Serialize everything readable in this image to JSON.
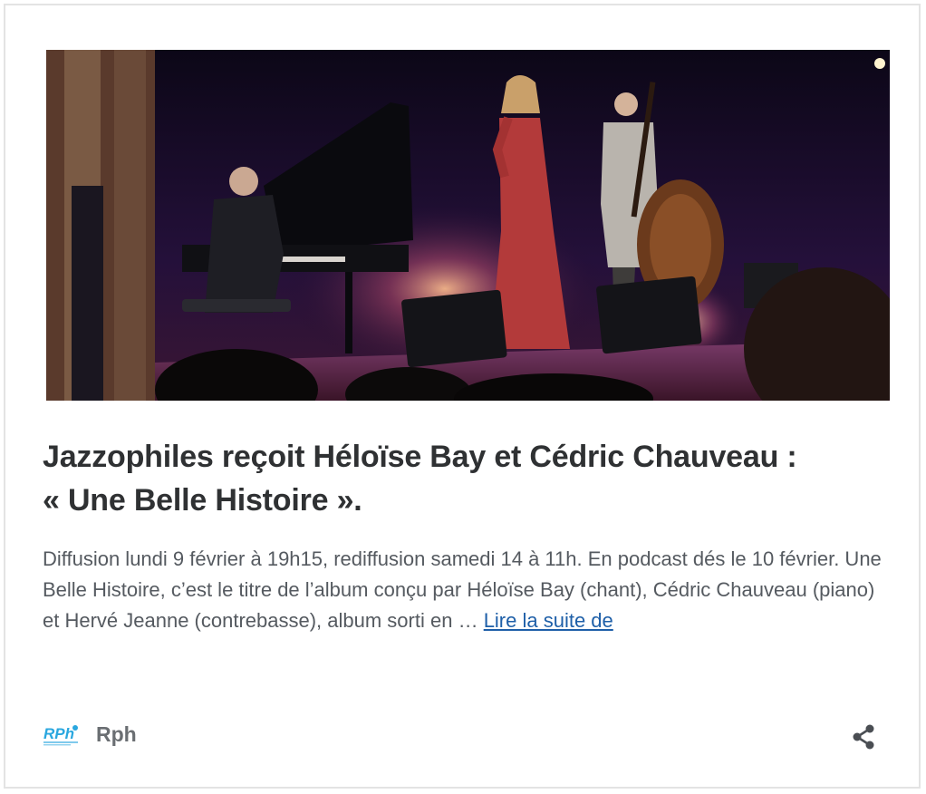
{
  "post": {
    "image_alt": "Jazz trio performing on stage",
    "title_line1": "Jazzophiles reçoit Héloïse Bay et Cédric Chauveau :",
    "title_line2": "« Une Belle Histoire ».",
    "excerpt": " Diffusion lundi 9 février à 19h15, rediffusion samedi 14 à 11h. En podcast dés le 10 février. Une Belle Histoire, c’est le titre de l’album conçu par Héloïse Bay (chant), Cédric Chauveau (piano) et Hervé Jeanne (contrebasse), album sorti en … ",
    "read_more": "Lire la suite de"
  },
  "footer": {
    "logo_text": "RPh",
    "author": "Rph",
    "share_icon": "share-icon"
  },
  "colors": {
    "title": "#2f3133",
    "text": "#555a60",
    "link": "#1e5fa8",
    "logo": "#2aa7df"
  }
}
